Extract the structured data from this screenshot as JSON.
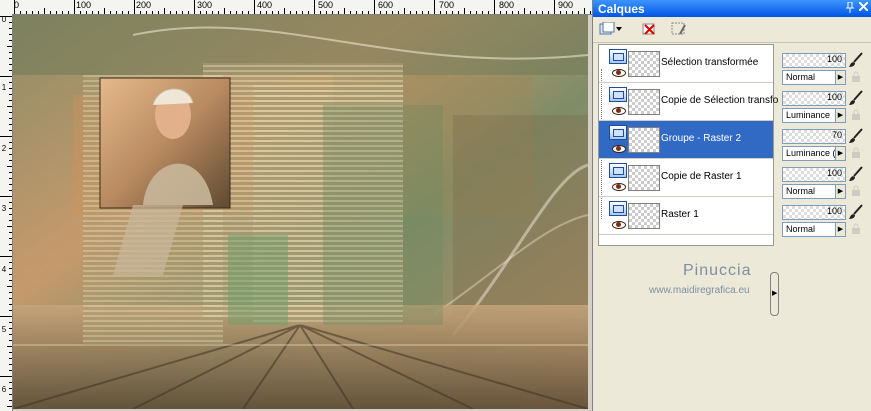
{
  "ruler": {
    "top_labels": [
      "0",
      "100",
      "200",
      "300",
      "400",
      "500",
      "600",
      "700",
      "800",
      "900"
    ],
    "left_labels": [
      "0",
      "1",
      "2",
      "3",
      "4",
      "5",
      "6"
    ]
  },
  "panel": {
    "title": "Calques",
    "pin_icon": "pin-icon",
    "close_icon": "close-icon"
  },
  "toolbar": {
    "icons": [
      "new-layer-icon",
      "delete-layer-icon",
      "layer-properties-icon"
    ]
  },
  "layers": [
    {
      "name": "Sélection transformée",
      "opacity": "100",
      "blend": "Normal",
      "selected": false
    },
    {
      "name": "Copie de Sélection transfo",
      "opacity": "100",
      "blend": "Luminance",
      "selected": false
    },
    {
      "name": "Groupe - Raster 2",
      "opacity": "70",
      "blend": "Luminance (H)",
      "selected": true
    },
    {
      "name": "Copie de Raster 1",
      "opacity": "100",
      "blend": "Normal",
      "selected": false
    },
    {
      "name": "Raster 1",
      "opacity": "100",
      "blend": "Normal",
      "selected": false
    }
  ],
  "watermark": {
    "name": "Pinuccia",
    "url": "www.maidiregrafica.eu"
  },
  "colors": {
    "selection": "#316ac5",
    "titlebar": "#0054e3"
  }
}
